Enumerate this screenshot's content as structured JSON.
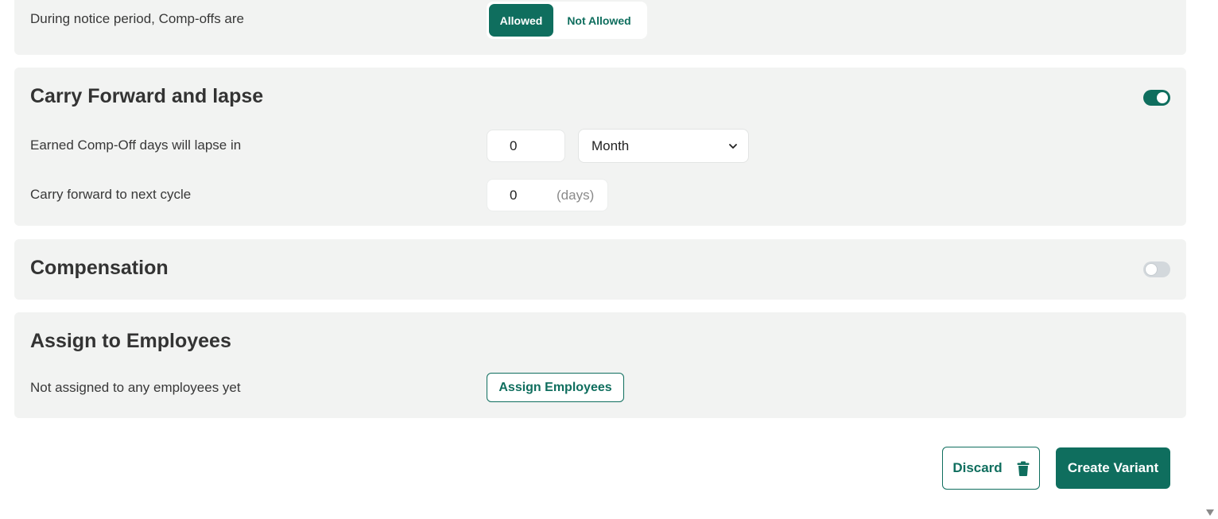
{
  "notice": {
    "label": "During notice period, Comp-offs are",
    "options": [
      "Allowed",
      "Not Allowed"
    ],
    "selected": "Allowed"
  },
  "carry": {
    "title": "Carry Forward and lapse",
    "enabled": true,
    "lapse_label": "Earned Comp-Off days will lapse in",
    "lapse_value": "0",
    "lapse_unit": "Month",
    "carry_label": "Carry forward to next cycle",
    "carry_value": "0",
    "carry_unit": "(days)"
  },
  "compensation": {
    "title": "Compensation",
    "enabled": false
  },
  "assign": {
    "title": "Assign to Employees",
    "status": "Not assigned to any employees yet",
    "button": "Assign Employees"
  },
  "footer": {
    "discard": "Discard",
    "create": "Create Variant"
  },
  "colors": {
    "accent": "#0f6e5e",
    "card_bg": "#f2f3f2"
  }
}
